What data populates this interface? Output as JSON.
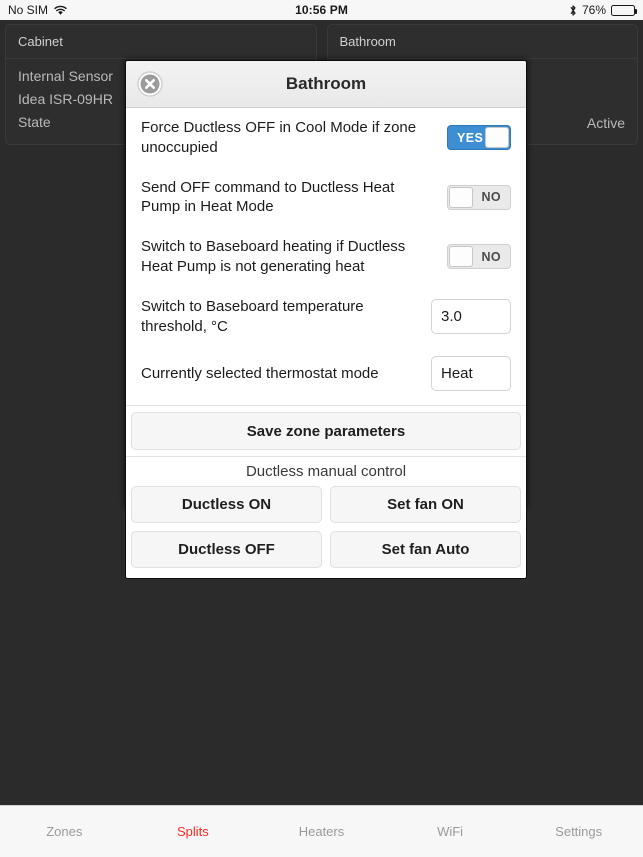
{
  "status_bar": {
    "carrier": "No SIM",
    "wifi_icon": "wifi-icon",
    "time": "10:56 PM",
    "bluetooth_icon": "bluetooth-icon",
    "battery_percent": "76%",
    "battery_level": 76
  },
  "background": {
    "cards": [
      {
        "title": "Cabinet",
        "lines": [
          "Internal Sensor",
          "Idea ISR-09HR",
          "State"
        ],
        "state": ""
      },
      {
        "title": "Bathroom",
        "lines": [
          "",
          "",
          ""
        ],
        "state": "Active"
      }
    ]
  },
  "modal": {
    "title": "Bathroom",
    "close_icon": "close-icon",
    "rows": [
      {
        "label": "Force Ductless OFF in Cool Mode if zone unoccupied",
        "control": "switch",
        "value": "YES",
        "on": true
      },
      {
        "label": "Send OFF command to Ductless Heat Pump in Heat Mode",
        "control": "switch",
        "value": "NO",
        "on": false
      },
      {
        "label": "Switch to Baseboard heating if Ductless Heat Pump is not generating heat",
        "control": "switch",
        "value": "NO",
        "on": false
      },
      {
        "label": "Switch to Baseboard temperature threshold, °C",
        "control": "input",
        "value": "3.0"
      },
      {
        "label": "Currently selected thermostat mode",
        "control": "input",
        "value": "Heat"
      }
    ],
    "save_label": "Save zone parameters",
    "manual_control_label": "Ductless manual control",
    "manual_buttons": [
      "Ductless ON",
      "Set fan ON",
      "Ductless OFF",
      "Set fan Auto"
    ]
  },
  "tab_bar": {
    "tabs": [
      {
        "label": "Zones",
        "active": false
      },
      {
        "label": "Splits",
        "active": true
      },
      {
        "label": "Heaters",
        "active": false
      },
      {
        "label": "WiFi",
        "active": false
      },
      {
        "label": "Settings",
        "active": false
      }
    ],
    "active_color": "#ff2a22",
    "inactive_color": "#9a9a9a"
  }
}
